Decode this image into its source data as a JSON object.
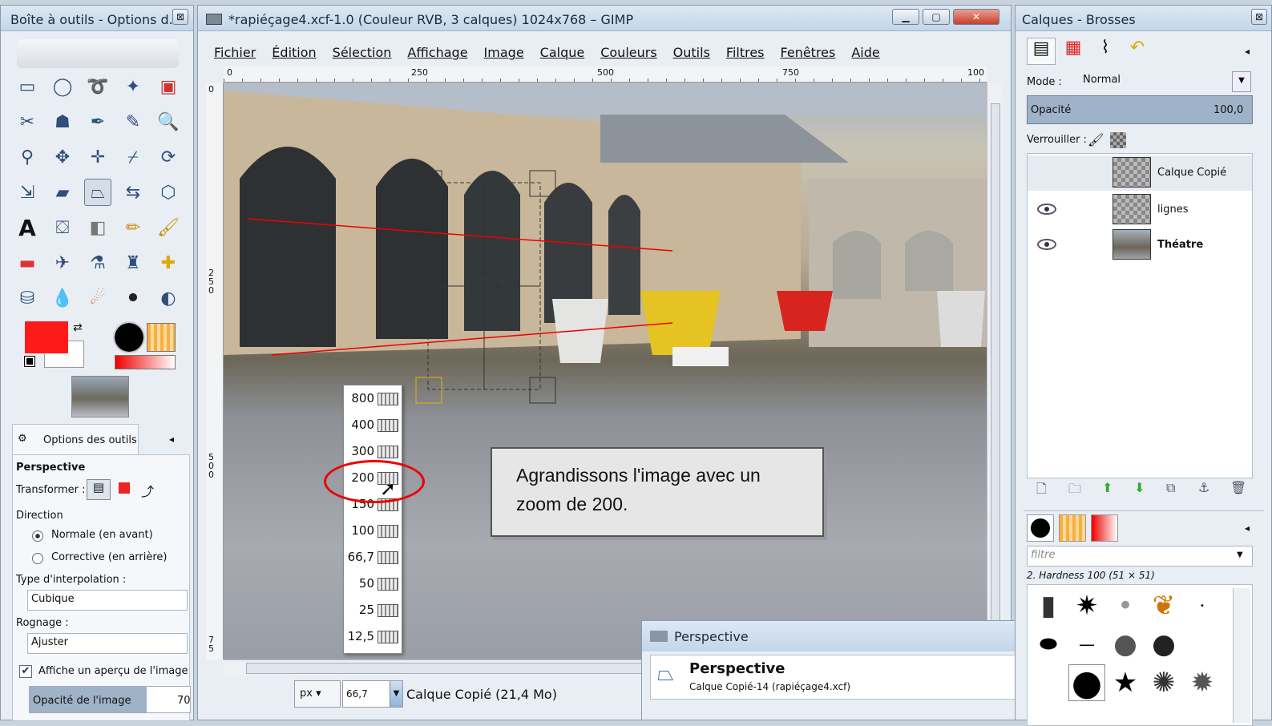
{
  "toolbox": {
    "title": "Boîte à outils - Options d...",
    "close": "⊠",
    "tool_options_tab": "Options des outils",
    "tool_name": "Perspective",
    "transform_label": "Transformer :",
    "direction_label": "Direction",
    "direction_forward": "Normale (en avant)",
    "direction_backward": "Corrective (en arrière)",
    "interp_label": "Type d'interpolation :",
    "interp_value": "Cubique",
    "clip_label": "Rognage :",
    "clip_value": "Ajuster",
    "preview_label": "Affiche un aperçu de l'image",
    "opacity_label": "Opacité de l'image",
    "opacity_value": "70"
  },
  "image_window": {
    "title": "*rapiéçage4.xcf-1.0 (Couleur RVB, 3 calques) 1024x768 – GIMP",
    "menu": [
      "Fichier",
      "Édition",
      "Sélection",
      "Affichage",
      "Image",
      "Calque",
      "Couleurs",
      "Outils",
      "Filtres",
      "Fenêtres",
      "Aide"
    ],
    "ruler_marks": [
      "0",
      "250",
      "500",
      "750",
      "100"
    ],
    "vruler_marks": [
      "0",
      "250",
      "500",
      "75"
    ],
    "unit": "px",
    "zoom_value": "66,7",
    "status": "Calque Copié (21,4 Mo)"
  },
  "zoom_menu": {
    "items": [
      "800",
      "400",
      "300",
      "200",
      "150",
      "100",
      "66,7",
      "50",
      "25",
      "12,5"
    ],
    "highlighted": "200"
  },
  "callout": {
    "text_line1": "Agrandissons l'image avec un",
    "text_line2": "zoom de 200."
  },
  "perspective_dialog": {
    "title": "Perspective",
    "heading": "Perspective",
    "subtitle": "Calque Copié-14 (rapiéçage4.xcf)"
  },
  "layers_panel": {
    "title": "Calques - Brosses",
    "mode_label": "Mode :",
    "mode_value": "Normal",
    "opacity_label": "Opacité",
    "opacity_value": "100,0",
    "lock_label": "Verrouiller :",
    "layers": [
      {
        "name": "Calque Copié",
        "visible": false
      },
      {
        "name": "lignes",
        "visible": true
      },
      {
        "name": "Théatre",
        "visible": true
      }
    ],
    "brush_filter": "filtre",
    "brush_name": "2. Hardness 100 (51 × 51)"
  },
  "colors": {
    "foreground": "#ff1a1a",
    "accent": "#e00000"
  }
}
